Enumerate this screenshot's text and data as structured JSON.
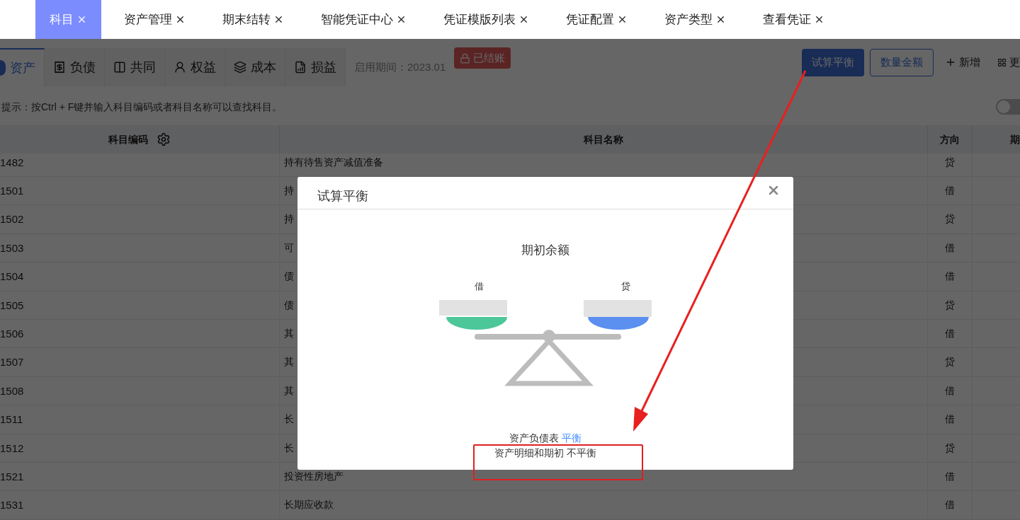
{
  "tabs": [
    {
      "label": "科目",
      "selected": true
    },
    {
      "label": "资产管理",
      "selected": false
    },
    {
      "label": "期末结转",
      "selected": false
    },
    {
      "label": "智能凭证中心",
      "selected": false
    },
    {
      "label": "凭证模版列表",
      "selected": false
    },
    {
      "label": "凭证配置",
      "selected": false
    },
    {
      "label": "资产类型",
      "selected": false
    },
    {
      "label": "查看凭证",
      "selected": false
    }
  ],
  "category_tabs": [
    {
      "label": "资产",
      "selected": true
    },
    {
      "label": "负债",
      "selected": false
    },
    {
      "label": "共同",
      "selected": false
    },
    {
      "label": "权益",
      "selected": false
    },
    {
      "label": "成本",
      "selected": false
    },
    {
      "label": "损益",
      "selected": false
    }
  ],
  "start_period": "启用期间：2023.01",
  "status_badge": "已结账",
  "buttons": [
    {
      "label": "试算平衡",
      "kind": "primary"
    },
    {
      "label": "数量金额",
      "kind": "outline"
    },
    {
      "label": "新增",
      "kind": "add"
    },
    {
      "label": "更",
      "kind": "more"
    }
  ],
  "hint": "提示：按Ctrl + F键并输入科目编码或者科目名称可以查找科目。",
  "toggle": {
    "on": false
  },
  "table": {
    "columns": [
      "科目编码",
      "科目名称",
      "方向",
      "期"
    ],
    "rows": [
      {
        "code": "1482",
        "name": "持有待售资产减值准备",
        "direction": "贷"
      },
      {
        "code": "1501",
        "name": "持",
        "direction": "借"
      },
      {
        "code": "1502",
        "name": "持",
        "direction": "贷"
      },
      {
        "code": "1503",
        "name": "可",
        "direction": "借"
      },
      {
        "code": "1504",
        "name": "债",
        "direction": "借"
      },
      {
        "code": "1505",
        "name": "债",
        "direction": "贷"
      },
      {
        "code": "1506",
        "name": "其",
        "direction": "借"
      },
      {
        "code": "1507",
        "name": "其",
        "direction": "贷"
      },
      {
        "code": "1508",
        "name": "其",
        "direction": "借"
      },
      {
        "code": "1511",
        "name": "长",
        "direction": "借"
      },
      {
        "code": "1512",
        "name": "长",
        "direction": "贷"
      },
      {
        "code": "1521",
        "name": "投资性房地产",
        "direction": "借"
      },
      {
        "code": "1531",
        "name": "长期应收款",
        "direction": "借"
      }
    ]
  },
  "dialog": {
    "title": "试算平衡",
    "heading": "期初余额",
    "debit_label": "借",
    "credit_label": "贷",
    "results": [
      {
        "label": "资产负债表",
        "status": "平衡",
        "balanced": true
      },
      {
        "label": "资产明细和期初",
        "status": "不平衡",
        "balanced": false
      }
    ]
  }
}
